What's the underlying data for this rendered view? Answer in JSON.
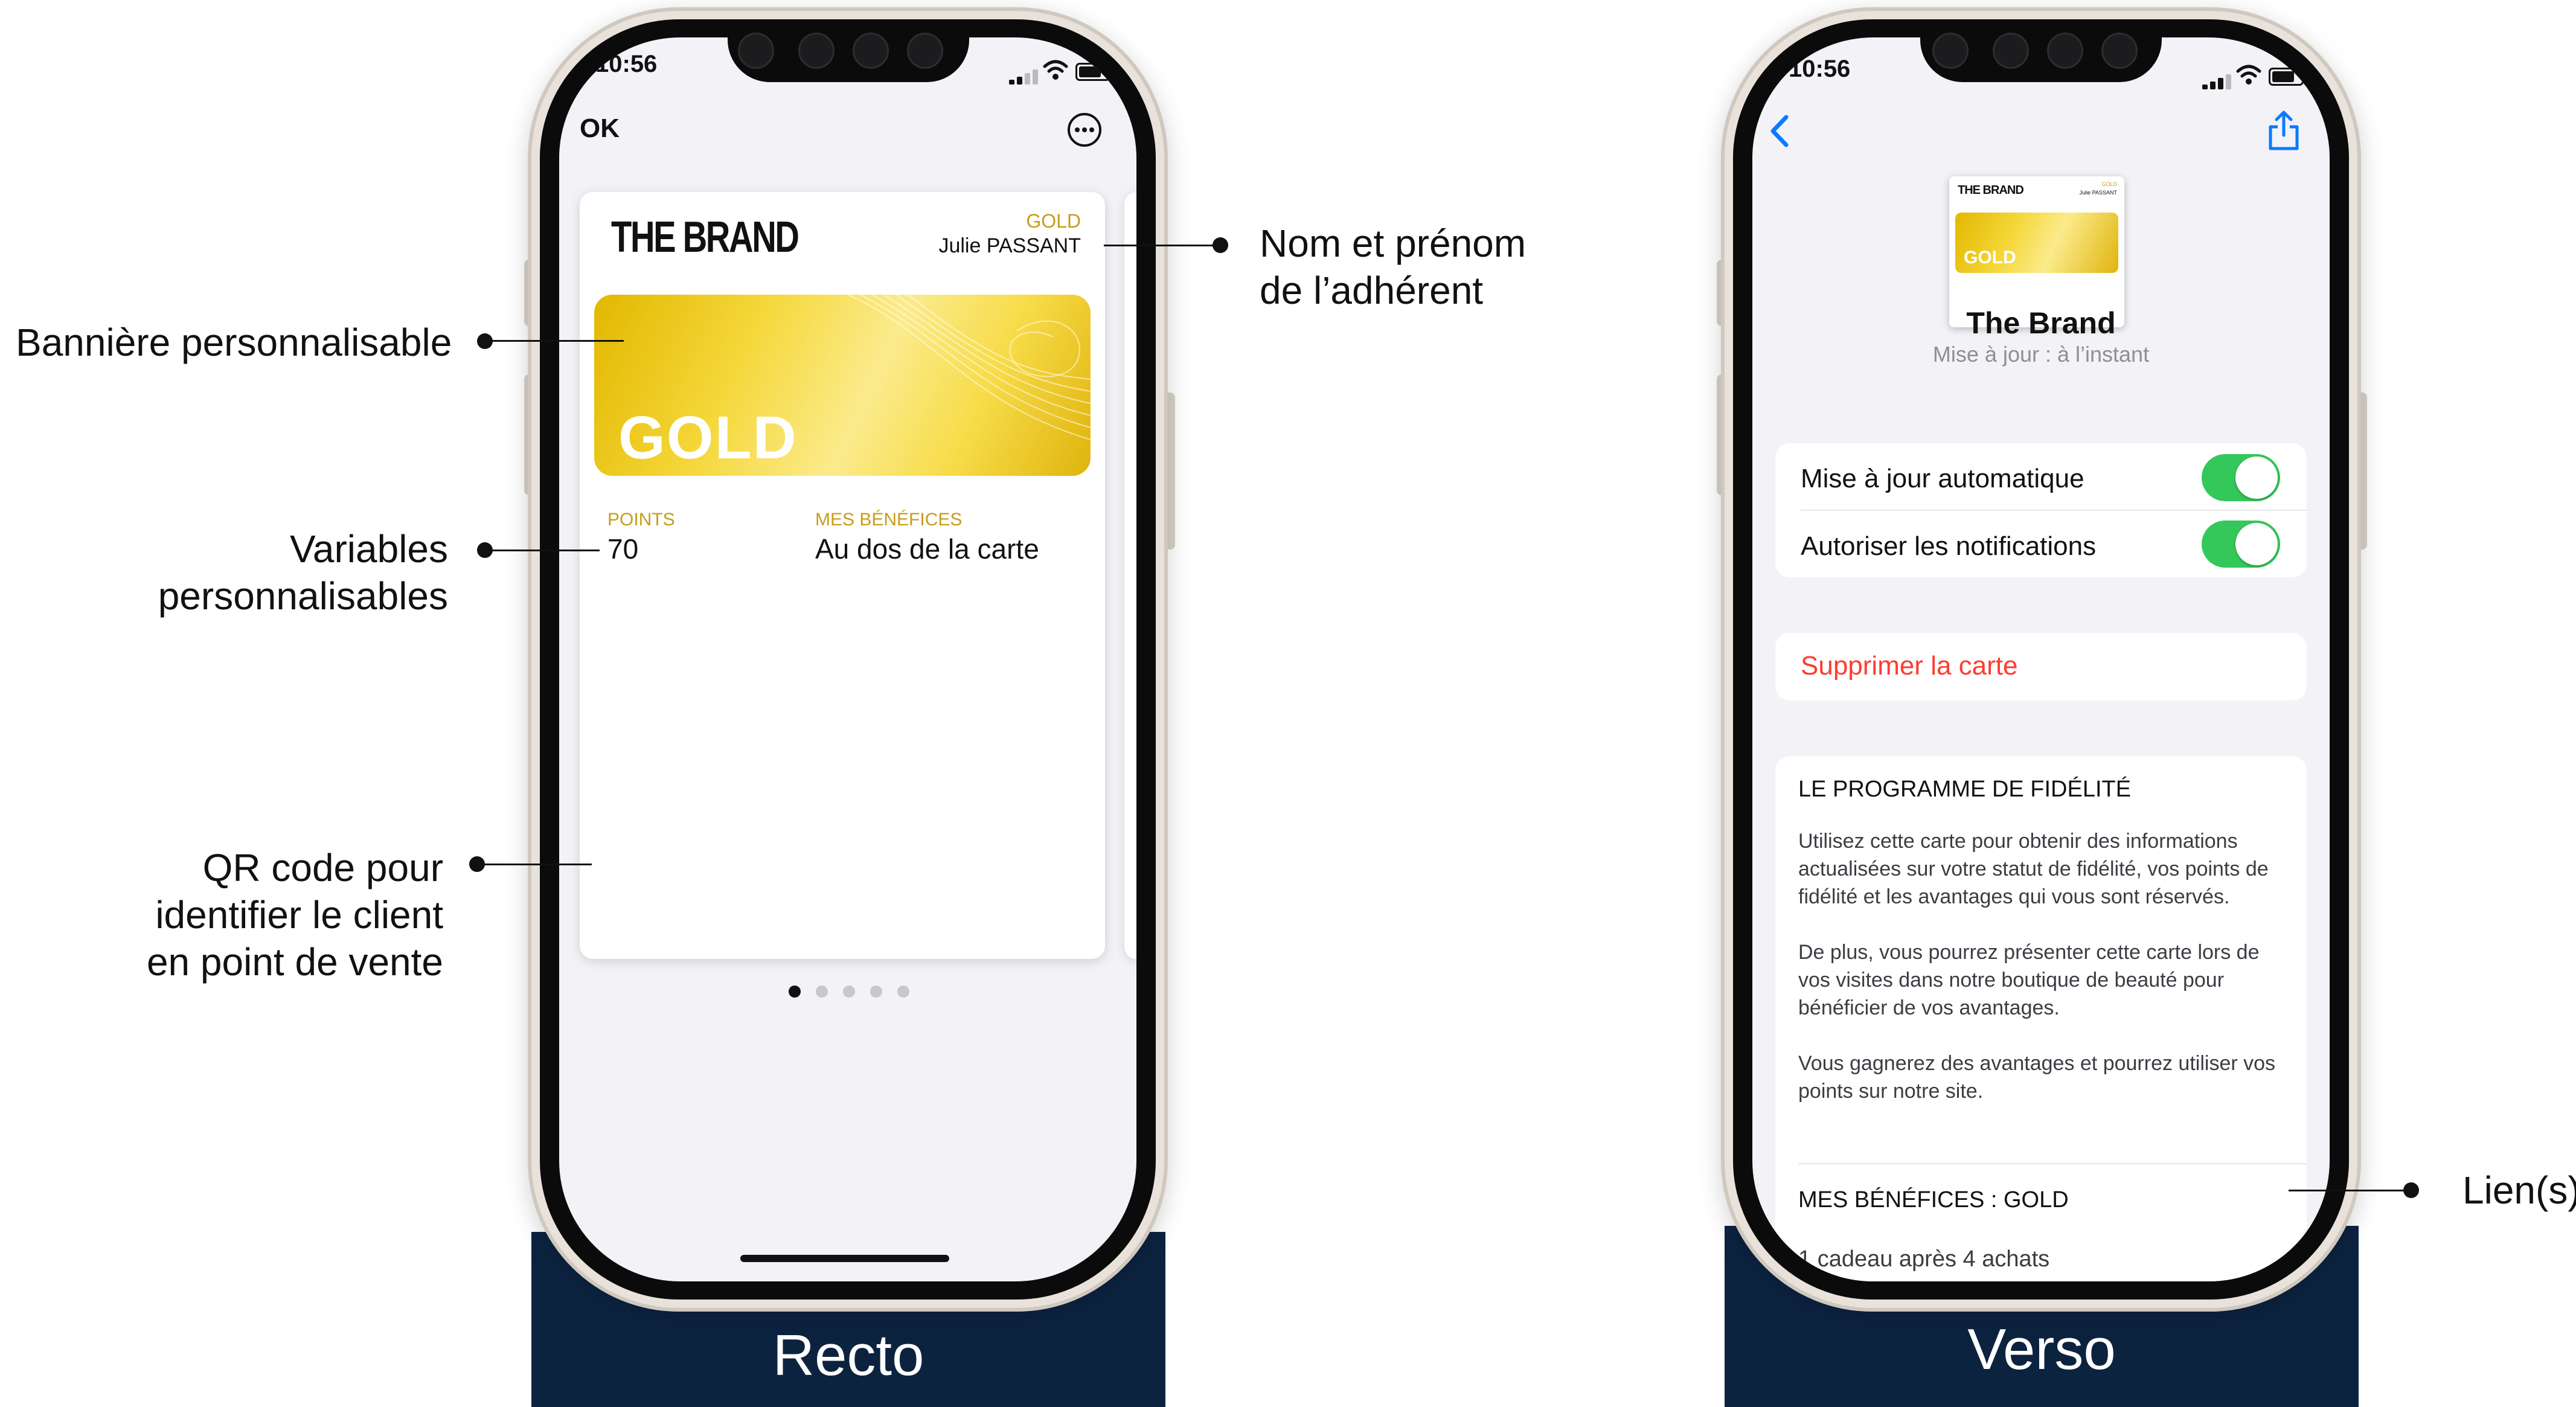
{
  "annotations": {
    "banner": "Bannière personnalisable",
    "variables_line1": "Variables",
    "variables_line2": "personnalisables",
    "qr_line1": "QR code pour",
    "qr_line2": "identifier le client",
    "qr_line3": "en point de vente",
    "name_line1": "Nom et prénom",
    "name_line2": "de l’adhérent",
    "links": "Lien(s)"
  },
  "labels": {
    "recto": "Recto",
    "verso": "Verso"
  },
  "recto": {
    "status_time": "10:56",
    "ok_label": "OK",
    "more_icon": "ellipsis-circle-icon",
    "brand_logo": "THE BRAND",
    "tier_label": "GOLD",
    "member_name": "Julie PASSANT",
    "banner_text": "GOLD",
    "field1": {
      "label": "POINTS",
      "value": "70"
    },
    "field2": {
      "label": "MES BÉNÉFICES",
      "value": "Au dos de la carte"
    },
    "page_dots": {
      "count": 5,
      "active": 0
    }
  },
  "verso": {
    "status_time": "10:56",
    "back_icon": "chevron-left-icon",
    "share_icon": "share-icon",
    "thumb_logo": "THE BRAND",
    "thumb_banner": "GOLD",
    "thumb_tier": "GOLD",
    "thumb_name": "Julie PASSANT",
    "title": "The Brand",
    "subtitle": "Mise à jour : à l’instant",
    "auto_update_label": "Mise à jour automatique",
    "auto_update_on": true,
    "notifications_label": "Autoriser les notifications",
    "notifications_on": true,
    "delete_label": "Supprimer la carte",
    "program_title": "LE PROGRAMME DE FIDÉLITÉ",
    "program_p1": "Utilisez cette carte pour obtenir des informations actualisées sur votre statut de fidélité, vos points de fidélité et les avantages qui vous sont réservés.",
    "program_p2": "De plus, vous pourrez présenter cette carte lors de vos visites dans notre boutique de beauté pour bénéficier de vos avantages.",
    "program_p3": "Vous gagnerez des avantages et pourrez utiliser vos points sur notre site.",
    "benefits_title": "MES BÉNÉFICES : GOLD",
    "benefits_value": "1 cadeau après 4 achats"
  },
  "colors": {
    "navy": "#0c2340",
    "gold_text": "#c89c1c",
    "ios_blue": "#0a7aff",
    "ios_red": "#ff3b30",
    "ios_green": "#34c759"
  }
}
